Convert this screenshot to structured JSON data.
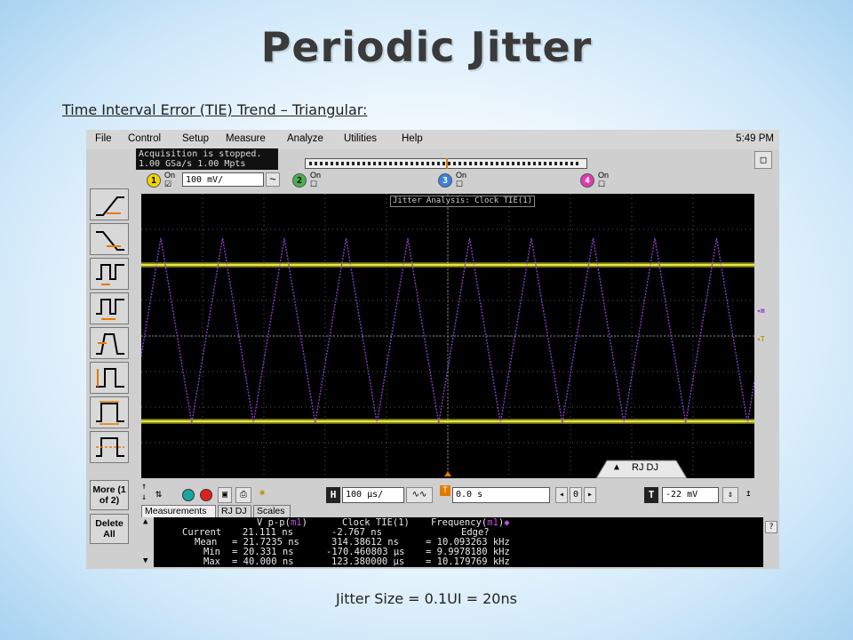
{
  "slide": {
    "title": "Periodic Jitter",
    "subtitle": "Time Interval Error (TIE) Trend – Triangular:",
    "caption": "Jitter Size = 0.1UI = 20ns"
  },
  "scope": {
    "menu": [
      "File",
      "Control",
      "Setup",
      "Measure",
      "Analyze",
      "Utilities",
      "Help"
    ],
    "clock": "5:49 PM",
    "status_lines": [
      "Acquisition is stopped.",
      "1.00 GSa/s   1.00 Mpts"
    ],
    "channels": [
      {
        "num": "1",
        "on_label": "On",
        "checked": true,
        "scale": "100 mV/"
      },
      {
        "num": "2",
        "on_label": "On",
        "checked": false
      },
      {
        "num": "3",
        "on_label": "On",
        "checked": false
      },
      {
        "num": "4",
        "on_label": "On",
        "checked": false
      }
    ],
    "screen_label": "Jitter Analysis: Clock TIE(1)",
    "rjdj_label": "RJ DJ",
    "sidebar_buttons": [
      "More (1 of 2)",
      "Delete All"
    ],
    "horizontal": {
      "h_label": "H",
      "scale": "100 µs/",
      "t_label": "T",
      "position": "0.0 s",
      "delay_step": "0",
      "trigger_level": "-22 mV"
    },
    "tabs": [
      "Measurements",
      "RJ DJ",
      "Scales"
    ],
    "measurements": {
      "headers": [
        "V p-p(",
        "m1",
        ")",
        "Clock TIE(1)",
        "Frequency(",
        "m1",
        ")"
      ],
      "sub_headers": [
        "",
        "",
        "",
        "",
        "Edge?"
      ],
      "rows": [
        {
          "label": "Current",
          "vpp": "21.111 ns",
          "tie": "-2.767 ns",
          "freq": "Edge?"
        },
        {
          "label": "Mean",
          "vpp": "= 21.7235 ns",
          "tie": "314.38612 ns",
          "freq": "= 10.093263 kHz"
        },
        {
          "label": "Min",
          "vpp": "= 20.331 ns",
          "tie": "-170.460803 µs",
          "freq": "= 9.9978180 kHz"
        },
        {
          "label": "Max",
          "vpp": "= 40.000 ns",
          "tie": "123.380000 µs",
          "freq": "= 10.179769 kHz"
        }
      ]
    },
    "colors": {
      "trace_yellow": "#e6e63a",
      "trace_purple": "#8a3ec8",
      "screen_bg": "#000000",
      "grid": "#5a5a5a"
    }
  }
}
